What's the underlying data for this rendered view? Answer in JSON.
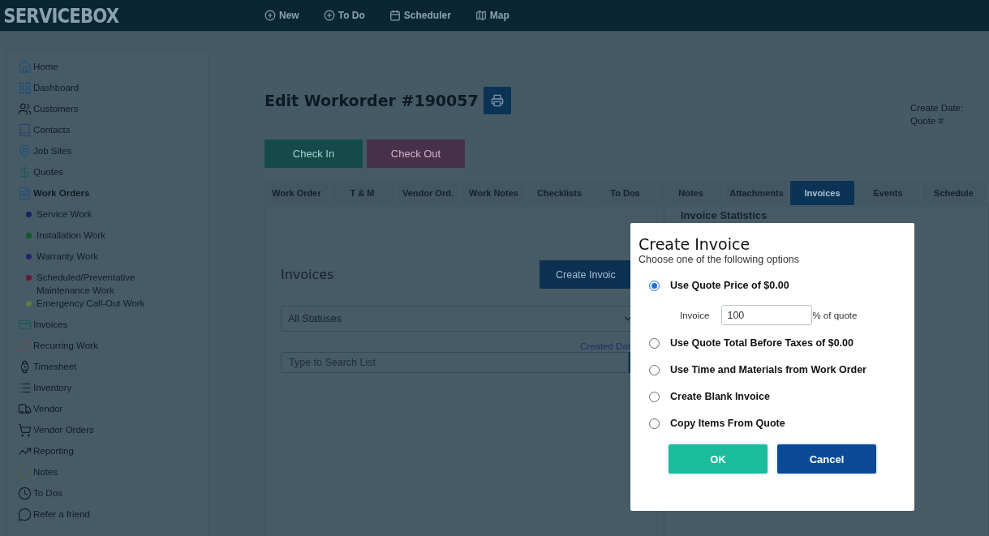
{
  "nav": {
    "logo": "SERVICEBOX",
    "items": [
      {
        "label": "New"
      },
      {
        "label": "To Do"
      },
      {
        "label": "Scheduler"
      },
      {
        "label": "Map"
      }
    ]
  },
  "sidebar": {
    "items": [
      {
        "label": "Home",
        "selected": false
      },
      {
        "label": "Dashboard",
        "selected": false
      },
      {
        "label": "Customers",
        "selected": false
      },
      {
        "label": "Contacts",
        "selected": false
      },
      {
        "label": "Job Sites",
        "selected": false
      },
      {
        "label": "Quotes",
        "selected": false
      },
      {
        "label": "Work Orders",
        "selected": true,
        "children": [
          {
            "label": "Service Work",
            "color": "#0e2466"
          },
          {
            "label": "Installation Work",
            "color": "#0f5a2a"
          },
          {
            "label": "Warranty Work",
            "color": "#2b1f70"
          },
          {
            "label": "Scheduled/Preventative Maintenance Work",
            "color": "#6a1a30"
          },
          {
            "label": "Emergency Call-Out Work",
            "color": "#5e7a3e"
          }
        ]
      },
      {
        "label": "Invoices",
        "selected": false
      },
      {
        "label": "Recurring Work",
        "selected": false
      },
      {
        "label": "Timesheet",
        "selected": false
      },
      {
        "label": "Inventory",
        "selected": false
      },
      {
        "label": "Vendor",
        "selected": false
      },
      {
        "label": "Vendor Orders",
        "selected": false
      },
      {
        "label": "Reporting",
        "selected": false
      },
      {
        "label": "Notes",
        "selected": false
      },
      {
        "label": "To Dos",
        "selected": false
      },
      {
        "label": "Refer a friend",
        "selected": false
      }
    ]
  },
  "page": {
    "title": "Edit Workorder #190057",
    "meta": [
      "Create Date:",
      "Quote #"
    ],
    "actions": [
      {
        "label": "Check In",
        "kind": "check-in"
      },
      {
        "label": "Check Out",
        "kind": "check-out"
      }
    ]
  },
  "tabs": [
    {
      "label": "Work Order",
      "selected": false
    },
    {
      "label": "T & M",
      "selected": false
    },
    {
      "label": "Vendor Ord.",
      "selected": false
    },
    {
      "label": "Work Notes",
      "selected": false
    },
    {
      "label": "Checklists",
      "selected": false
    },
    {
      "label": "To Dos",
      "selected": false
    },
    {
      "label": "Notes",
      "selected": false
    },
    {
      "label": "Attachments",
      "selected": false
    },
    {
      "label": "Invoices",
      "selected": true
    },
    {
      "label": "Events",
      "selected": false
    },
    {
      "label": "Schedule",
      "selected": false
    }
  ],
  "invoices_panel": {
    "title": "Invoices",
    "create_button": "Create Invoic",
    "status_filter": "All Statuses",
    "sort_label": "Created Dat",
    "search": {
      "placeholder": "Type to Search List"
    }
  },
  "stats_panel": {
    "title": "Invoice Statistics"
  },
  "dialog": {
    "title": "Create Invoice",
    "subtitle": "Choose one of the following options",
    "options": [
      {
        "label": "Use Quote Price of $0.00",
        "selected": true,
        "field": {
          "label": "Invoice",
          "value": "100",
          "suffix": "% of quote"
        }
      },
      {
        "label": "Use Quote Total Before Taxes of $0.00",
        "selected": false
      },
      {
        "label": "Use Time and Materials from Work Order",
        "selected": false
      },
      {
        "label": "Create Blank Invoice",
        "selected": false
      },
      {
        "label": "Copy Items From Quote",
        "selected": false
      }
    ],
    "buttons": [
      {
        "label": "OK",
        "kind": "ok"
      },
      {
        "label": "Cancel",
        "kind": "cancel"
      }
    ]
  }
}
